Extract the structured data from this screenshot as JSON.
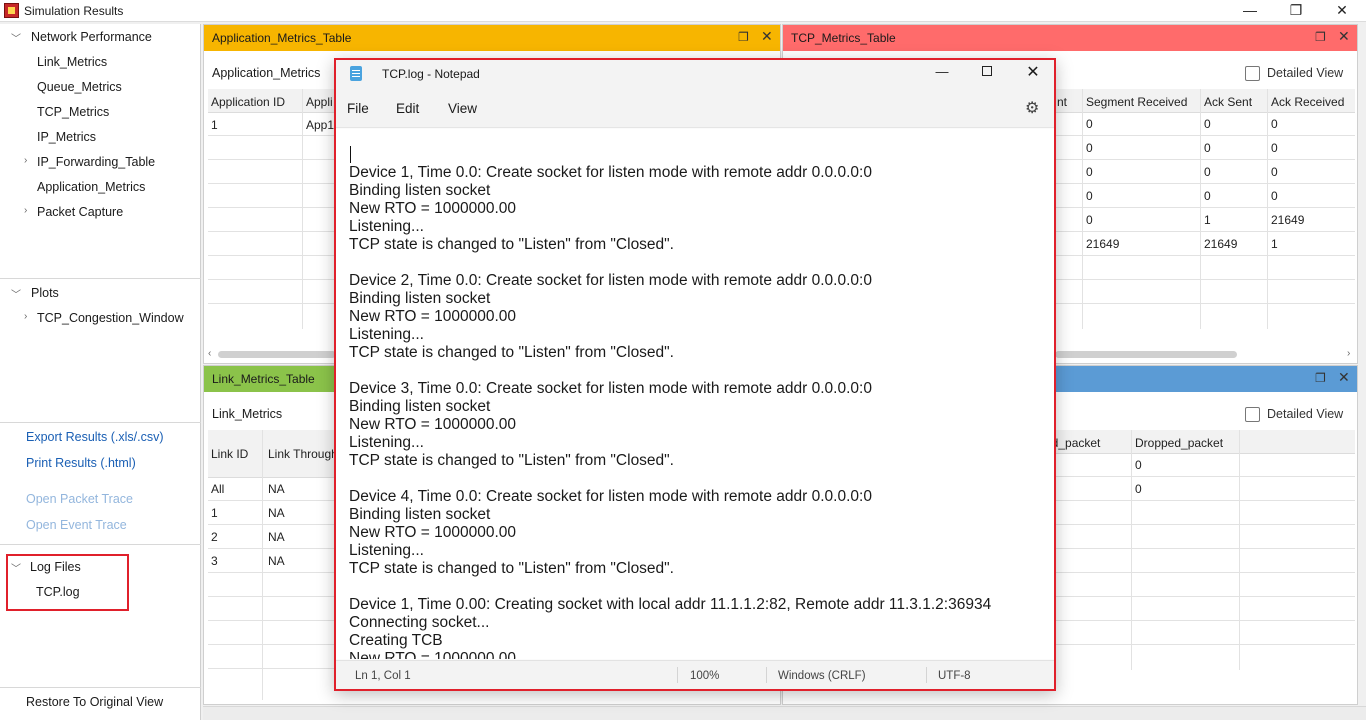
{
  "window": {
    "title": "Simulation Results",
    "min_glyph": "—",
    "restore_glyph": "❐",
    "close_glyph": "✕"
  },
  "sidebar": {
    "network_performance": "Network Performance",
    "items": [
      "Link_Metrics",
      "Queue_Metrics",
      "TCP_Metrics",
      "IP_Metrics",
      "IP_Forwarding_Table",
      "Application_Metrics",
      "Packet Capture"
    ],
    "plots": "Plots",
    "plot_items": [
      "TCP_Congestion_Window"
    ],
    "export": "Export Results (.xls/.csv)",
    "print": "Print Results (.html)",
    "open_packet_trace": "Open Packet Trace",
    "open_event_trace": "Open Event Trace",
    "log_files": "Log Files",
    "log_items": [
      "TCP.log"
    ],
    "restore": "Restore To Original View"
  },
  "app_panel": {
    "tab": "Application_Metrics_Table",
    "tab_color": "#f7b500",
    "subtitle": "Application_Metrics",
    "columns": [
      "Application ID",
      "Appli"
    ],
    "rows": [
      [
        "1",
        "App1"
      ]
    ]
  },
  "tcp_panel": {
    "tab": "TCP_Metrics_Table",
    "tab_color": "#ff6b6b",
    "detailed_view": "Detailed View",
    "columns": [
      "nt",
      "Segment Received",
      "Ack Sent",
      "Ack Received"
    ],
    "rows": [
      [
        "",
        "0",
        "0",
        "0"
      ],
      [
        "",
        "0",
        "0",
        "0"
      ],
      [
        "",
        "0",
        "0",
        "0"
      ],
      [
        "",
        "0",
        "0",
        "0"
      ],
      [
        "",
        "0",
        "1",
        "21649"
      ],
      [
        "",
        "21649",
        "21649",
        "1"
      ]
    ]
  },
  "link_panel": {
    "tab": "Link_Metrics_Table",
    "tab_color": "#8bc34a",
    "subtitle": "Link_Metrics",
    "columns": [
      "Link ID",
      "Link Through"
    ],
    "rows": [
      [
        "All",
        "NA"
      ],
      [
        "1",
        "NA"
      ],
      [
        "2",
        "NA"
      ],
      [
        "3",
        "NA"
      ]
    ]
  },
  "queue_panel": {
    "tab_color": "#5b9bd5",
    "detailed_view": "Detailed View",
    "columns": [
      "ed_packet",
      "Dropped_packet"
    ],
    "rows": [
      [
        "",
        "0"
      ],
      [
        "",
        "0"
      ]
    ]
  },
  "notepad": {
    "title": "TCP.log - Notepad",
    "menu": [
      "File",
      "Edit",
      "View"
    ],
    "lines": [
      "Device 1, Time 0.0: Create socket for listen mode with remote addr 0.0.0.0:0",
      "Binding listen socket",
      "New RTO = 1000000.00",
      "Listening...",
      "TCP state is changed to \"Listen\" from \"Closed\".",
      "",
      "Device 2, Time 0.0: Create socket for listen mode with remote addr 0.0.0.0:0",
      "Binding listen socket",
      "New RTO = 1000000.00",
      "Listening...",
      "TCP state is changed to \"Listen\" from \"Closed\".",
      "",
      "Device 3, Time 0.0: Create socket for listen mode with remote addr 0.0.0.0:0",
      "Binding listen socket",
      "New RTO = 1000000.00",
      "Listening...",
      "TCP state is changed to \"Listen\" from \"Closed\".",
      "",
      "Device 4, Time 0.0: Create socket for listen mode with remote addr 0.0.0.0:0",
      "Binding listen socket",
      "New RTO = 1000000.00",
      "Listening...",
      "TCP state is changed to \"Listen\" from \"Closed\".",
      "",
      "Device 1, Time 0.00: Creating socket with local addr 11.1.1.2:82, Remote addr 11.3.1.2:36934",
      "Connecting socket...",
      "Creating TCB",
      "New RTO = 1000000.00"
    ],
    "status": {
      "position": "Ln 1, Col 1",
      "zoom": "100%",
      "line_ending": "Windows (CRLF)",
      "encoding": "UTF-8"
    }
  }
}
